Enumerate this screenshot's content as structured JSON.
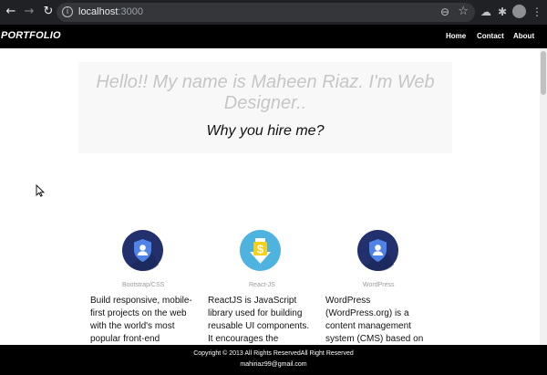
{
  "browser": {
    "url_host": "localhost",
    "url_port": ":3000",
    "icons": [
      "back-icon",
      "forward-icon",
      "reload-icon",
      "info-icon",
      "zoom-icon",
      "star-icon",
      "extension-icon",
      "puzzle-icon",
      "profile-avatar",
      "menu-icon"
    ]
  },
  "navbar": {
    "brand": "PORTFOLIO",
    "links": [
      "Home",
      "Contact",
      "About"
    ]
  },
  "hero": {
    "title": "Hello!! My name is Maheen Riaz. I'm Web Designer..",
    "subtitle": "Why you hire me?"
  },
  "skills": [
    {
      "label": "Bootstrap/CSS",
      "icon": "shield-user-icon",
      "color": "#22316d",
      "description": "Build responsive, mobile-first projects on the web with the world's most popular front-end"
    },
    {
      "label": "React-JS",
      "icon": "dollar-download-icon",
      "color": "#4fb3e0",
      "description": "ReactJS is JavaScript library used for building reusable UI components. It encourages the creation of"
    },
    {
      "label": "WordPress",
      "icon": "shield-user-icon",
      "color": "#22316d",
      "description": "WordPress (WordPress.org) is a content management system (CMS) based on PHP and MySQL that is"
    }
  ],
  "footer": {
    "copyright": "Copyright © 2013 All Rights ReservedAll Right Reserved",
    "email": "mahiriaz99@gmail.com"
  },
  "colors": {
    "navbar_bg": "#000000",
    "hero_bg": "#f8f8f8",
    "hero_title": "#c6c6c6",
    "skill_label": "#9b9b9b"
  }
}
